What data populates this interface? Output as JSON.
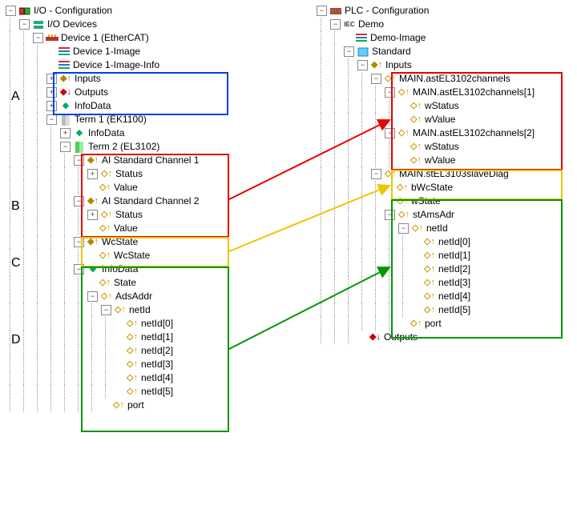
{
  "letters": {
    "A": "A",
    "B": "B",
    "C": "C",
    "D": "D"
  },
  "io": {
    "root": "I/O - Configuration",
    "devices": "I/O Devices",
    "device1": "Device 1 (EtherCAT)",
    "device1image": "Device 1-Image",
    "device1imageinfo": "Device 1-Image-Info",
    "inputs": "Inputs",
    "outputs": "Outputs",
    "infodata": "InfoData",
    "term1": "Term 1 (EK1100)",
    "term2": "Term 2 (EL3102)",
    "aich1": "AI Standard Channel 1",
    "aich2": "AI Standard Channel 2",
    "status": "Status",
    "value": "Value",
    "wcstate_parent": "WcState",
    "wcstate": "WcState",
    "infodata2": "InfoData",
    "state": "State",
    "adsaddr": "AdsAddr",
    "netid": "netId",
    "netid0": "netId[0]",
    "netid1": "netId[1]",
    "netid2": "netId[2]",
    "netid3": "netId[3]",
    "netid4": "netId[4]",
    "netid5": "netId[5]",
    "port": "port"
  },
  "plc": {
    "root": "PLC - Configuration",
    "demo": "Demo",
    "demoimage": "Demo-Image",
    "standard": "Standard",
    "inputs": "Inputs",
    "main_channels": "MAIN.astEL3102channels",
    "main_ch1": "MAIN.astEL3102channels[1]",
    "main_ch2": "MAIN.astEL3102channels[2]",
    "wStatus": "wStatus",
    "wValue": "wValue",
    "slaveDiag": "MAIN.stEL3103slaveDiag",
    "bWcState": "bWcState",
    "wState": "wState",
    "stAmsAdr": "stAmsAdr",
    "netid": "netId",
    "netid0": "netId[0]",
    "netid1": "netId[1]",
    "netid2": "netId[2]",
    "netid3": "netId[3]",
    "netid4": "netId[4]",
    "netid5": "netId[5]",
    "port": "port",
    "outputs": "Outputs"
  }
}
